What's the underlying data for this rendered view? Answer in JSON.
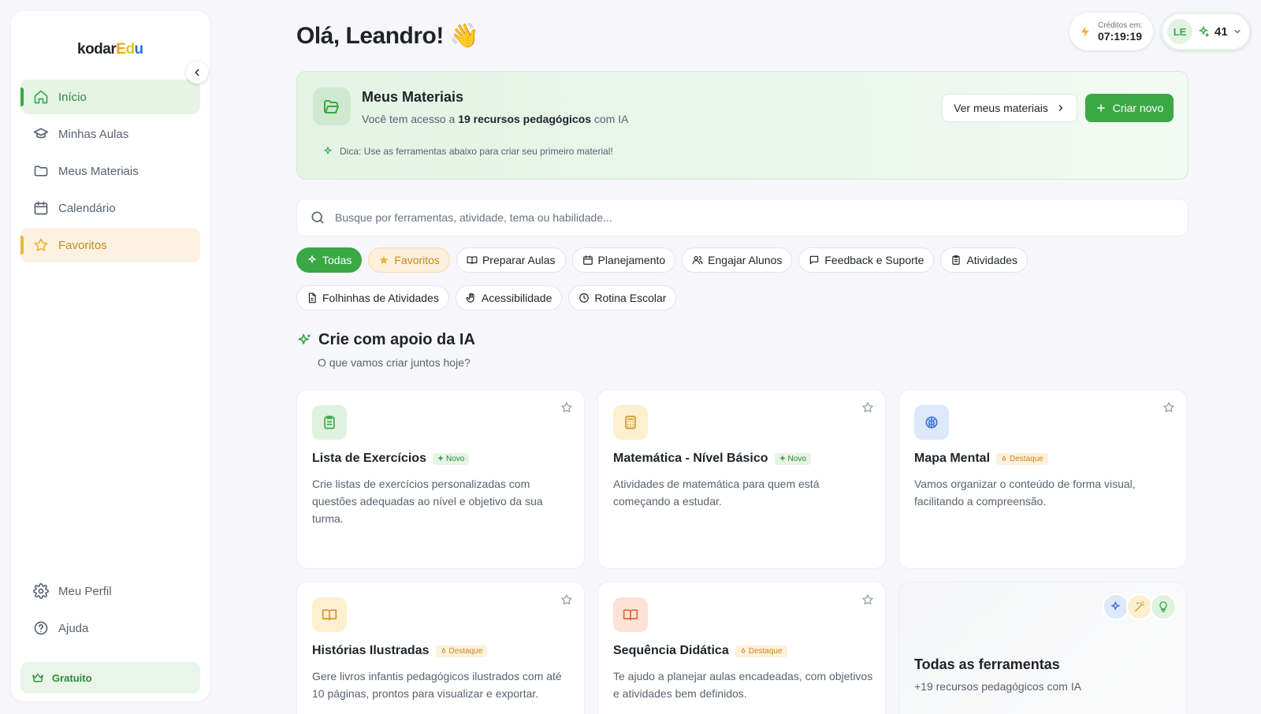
{
  "app": {
    "logo_prefix": "kodar",
    "logo_e": "E",
    "logo_d": "d",
    "logo_u": "u"
  },
  "sidebar": {
    "items": [
      {
        "label": "Início"
      },
      {
        "label": "Minhas Aulas"
      },
      {
        "label": "Meus Materiais"
      },
      {
        "label": "Calendário"
      },
      {
        "label": "Favoritos"
      }
    ],
    "bottom": [
      {
        "label": "Meu Perfil"
      },
      {
        "label": "Ajuda"
      }
    ],
    "plan": "Gratuito"
  },
  "header": {
    "greeting": "Olá, Leandro! 👋",
    "credits_label": "Créditos em:",
    "credits_time": "07:19:19",
    "user_initials": "LE",
    "user_credits": "41"
  },
  "materials": {
    "title": "Meus Materiais",
    "sub_prefix": "Você tem acesso a ",
    "sub_bold": "19 recursos pedagógicos",
    "sub_suffix": " com IA",
    "tip": "Dica: Use as ferramentas abaixo para criar seu primeiro material!",
    "view_button": "Ver meus materiais",
    "create_button": "Criar novo"
  },
  "search": {
    "placeholder": "Busque por ferramentas, atividade, tema ou habilidade..."
  },
  "filters": [
    {
      "label": "Todas",
      "icon": "sparkle-icon"
    },
    {
      "label": "Favoritos",
      "icon": "star-icon"
    },
    {
      "label": "Preparar Aulas",
      "icon": "book-icon"
    },
    {
      "label": "Planejamento",
      "icon": "calendar-icon"
    },
    {
      "label": "Engajar Alunos",
      "icon": "users-icon"
    },
    {
      "label": "Feedback e Suporte",
      "icon": "message-icon"
    },
    {
      "label": "Atividades",
      "icon": "clipboard-icon"
    },
    {
      "label": "Folhinhas de Atividades",
      "icon": "file-icon"
    },
    {
      "label": "Acessibilidade",
      "icon": "hand-icon"
    },
    {
      "label": "Rotina Escolar",
      "icon": "clock-icon"
    }
  ],
  "section": {
    "title": "Crie com apoio da IA",
    "subtitle": "O que vamos criar juntos hoje?"
  },
  "tools": [
    {
      "title": "Lista de Exercícios",
      "tag": "Novo",
      "desc": "Crie listas de exercícios personalizadas com questões adequadas ao nível e objetivo da sua turma.",
      "icon": "clipboard-icon",
      "color": "#3aa845"
    },
    {
      "title": "Matemática - Nível Básico",
      "tag": "Novo",
      "desc": "Atividades de matemática para quem está começando a estudar.",
      "icon": "calculator-icon",
      "color": "#d4962a"
    },
    {
      "title": "Mapa Mental",
      "tag": "Destaque",
      "desc": "Vamos organizar o conteúdo de forma visual, facilitando a compreensão.",
      "icon": "brain-icon",
      "color": "#3b6fd6"
    },
    {
      "title": "Histórias Ilustradas",
      "tag": "Destaque",
      "desc": "Gere livros infantis pedagógicos ilustrados com até 10 páginas, prontos para visualizar e exportar.",
      "icon": "book-open-icon",
      "color": "#d4962a"
    },
    {
      "title": "Sequência Didática",
      "tag": "Destaque",
      "desc": "Te ajudo a planejar aulas encadeadas, com objetivos e atividades bem definidos.",
      "icon": "book-open-icon",
      "color": "#e0663a"
    }
  ],
  "all_tools": {
    "title": "Todas as ferramentas",
    "subtitle": "+19 recursos pedagógicos com IA"
  },
  "colors": {
    "accent": "#3aa845",
    "favorite": "#f0b23a"
  }
}
